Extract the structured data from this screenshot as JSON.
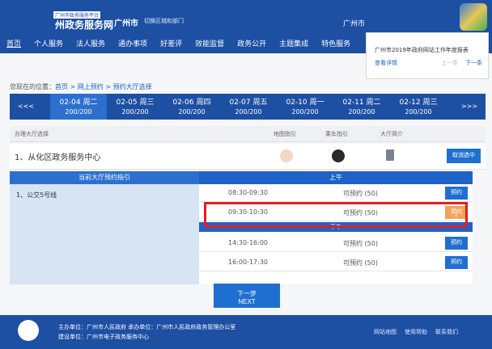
{
  "header": {
    "logo_small": "广州市政务服务平台",
    "logo_main": "州政务服务网",
    "city": "广州市",
    "switch": "切换区城和部门",
    "city_right": "广州市"
  },
  "nav": [
    "首页",
    "个人服务",
    "法人服务",
    "通办事项",
    "好差评",
    "效能监督",
    "政务公开",
    "主题集成",
    "特色服务"
  ],
  "popup": {
    "title": "广州市2019年政府网站工作年度报表",
    "detail": "查看详情",
    "prev": "上一条",
    "next": "下一条"
  },
  "breadcrumb": {
    "prefix": "您现在的位置：",
    "path": "首页 > 网上预约 > 预约大厅选择"
  },
  "datebar": {
    "prev": "<<<",
    "next": ">>>",
    "dates": [
      {
        "date": "02-04 周二",
        "count": "200/200"
      },
      {
        "date": "02-05 周三",
        "count": "200/200"
      },
      {
        "date": "02-06 周四",
        "count": "200/200"
      },
      {
        "date": "02-07 周五",
        "count": "200/200"
      },
      {
        "date": "02-10 周一",
        "count": "200/200"
      },
      {
        "date": "02-11 周二",
        "count": "200/200"
      },
      {
        "date": "02-12 周三",
        "count": "200/200"
      }
    ]
  },
  "table": {
    "head_hall": "办理大厅选择",
    "head_map": "地图指引",
    "head_bus": "乘车指引",
    "head_intro": "大厅简介",
    "hall_name": "1、从化区政务服务中心",
    "cancel": "取消选中"
  },
  "guide": {
    "title": "当前大厅预约指引",
    "item": "1、公交5号线"
  },
  "slots": {
    "am_label": "上午",
    "pm_label": "下午",
    "book_label": "预约",
    "items": [
      {
        "time": "08:30-09:30",
        "avail": "可预约 (50)"
      },
      {
        "time": "09:30-10:30",
        "avail": "可预约 (50)"
      },
      {
        "time": "14:30-16:00",
        "avail": "可预约 (50)"
      },
      {
        "time": "16:00-17:30",
        "avail": "可预约 (50)"
      }
    ]
  },
  "next_button": {
    "line1": "下一步",
    "line2": "NEXT"
  },
  "footer": {
    "line1": "主办单位：广州市人民政府  承办单位：广州市人民政府政务管理办公室",
    "line2": "建设单位：广州市电子政务服务中心",
    "links": [
      "网站地图",
      "使用帮助",
      "联系我们"
    ]
  },
  "colors": {
    "primary": "#1d4fa3",
    "button": "#1f6fd0",
    "highlight": "#e02020",
    "hover_button": "#f0a35a"
  }
}
